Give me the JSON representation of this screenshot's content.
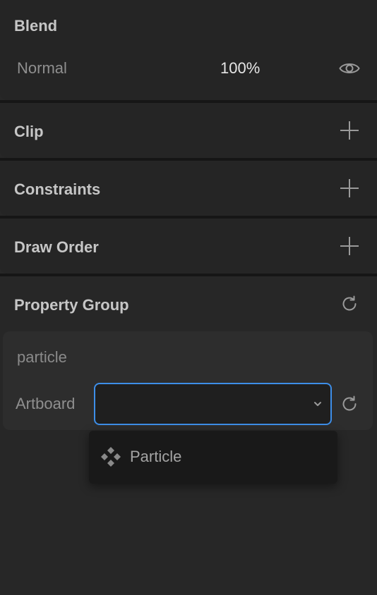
{
  "blend": {
    "title": "Blend",
    "mode": "Normal",
    "opacity": "100%"
  },
  "sections": {
    "clip": "Clip",
    "constraints": "Constraints",
    "draw_order": "Draw Order",
    "property_group": "Property Group"
  },
  "property_group": {
    "item_name": "particle",
    "field_label": "Artboard",
    "selected_value": "",
    "options": [
      {
        "label": "Particle",
        "icon": "component-icon"
      }
    ]
  },
  "colors": {
    "background": "#272727",
    "panel": "#252525",
    "card": "#2d2d2d",
    "accent": "#3d8ee8",
    "dropdown": "#191919"
  }
}
